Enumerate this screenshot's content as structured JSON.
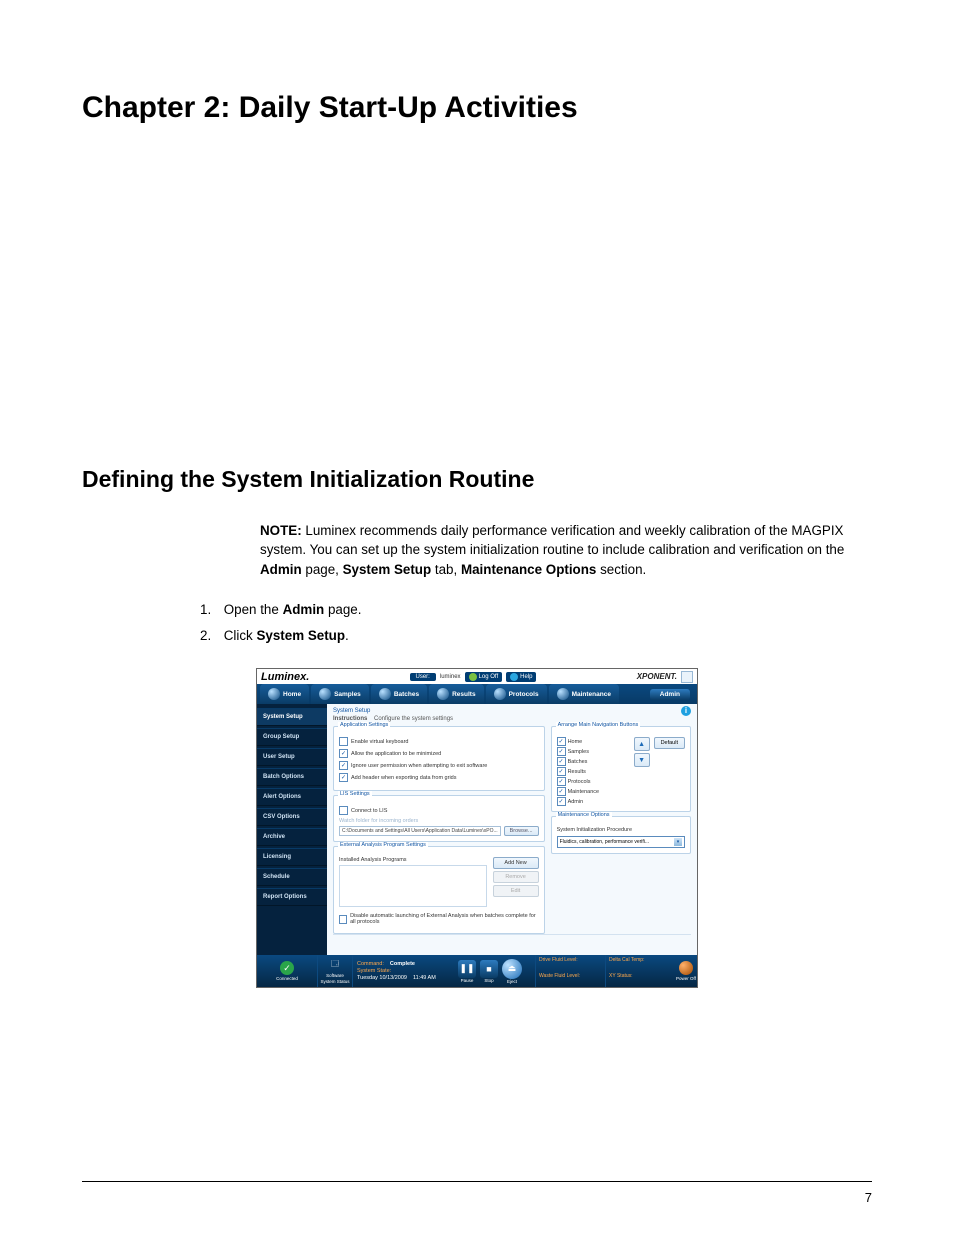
{
  "chapter_title": "Chapter 2: Daily Start-Up Activities",
  "section_title": "Defining the System Initialization Routine",
  "note": {
    "label": "NOTE:",
    "text_before": " Luminex recommends daily performance verification and weekly calibration of the MAGPIX system. You can set up the system initialization routine to include calibration and verification on the ",
    "bold1": "Admin",
    "mid1": " page, ",
    "bold2": "System Setup",
    "mid2": " tab, ",
    "bold3": "Maintenance Options",
    "tail": " section."
  },
  "steps": {
    "s1_a": "Open the ",
    "s1_b": "Admin",
    "s1_c": " page.",
    "s2_a": "Click ",
    "s2_b": "System Setup",
    "s2_c": "."
  },
  "page_number": "7",
  "screenshot": {
    "brand": "Luminex.",
    "user_label": "User:",
    "user_value": "luminex",
    "logoff": "Log Off",
    "help": "Help",
    "product": "XPONENT.",
    "nav": {
      "home": "Home",
      "samples": "Samples",
      "batches": "Batches",
      "results": "Results",
      "protocols": "Protocols",
      "maintenance": "Maintenance",
      "admin": "Admin"
    },
    "sidebar": [
      "System Setup",
      "Group Setup",
      "User Setup",
      "Batch Options",
      "Alert Options",
      "CSV Options",
      "Archive",
      "Licensing",
      "Schedule",
      "Report Options"
    ],
    "crumb": "System Setup",
    "instructions_label": "Instructions",
    "instructions_text": "Configure the system settings",
    "app_settings": {
      "legend": "Application Settings",
      "c1": "Enable virtual keyboard",
      "c2": "Allow the application to be minimized",
      "c3": "Ignore user permission when attempting to exit software",
      "c4": "Add header when exporting data from grids"
    },
    "lis": {
      "legend": "LIS Settings",
      "connect": "Connect to LIS",
      "watch": "Watch folder for incoming orders",
      "path": "C:\\Documents and Settings\\All Users\\Application Data\\Luminex\\xPO...",
      "browse": "Browse..."
    },
    "ext": {
      "legend": "External Analysis Program Settings",
      "label": "Installed Analysis Programs",
      "add": "Add New",
      "remove": "Remove",
      "edit": "Edit",
      "disable": "Disable automatic launching of External Analysis when batches complete for all protocols"
    },
    "arrange": {
      "legend": "Arrange Main Navigation Buttons",
      "items": [
        "Home",
        "Samples",
        "Batches",
        "Results",
        "Protocols",
        "Maintenance",
        "Admin"
      ],
      "default": "Default"
    },
    "maint": {
      "legend": "Maintenance Options",
      "label": "System Initialization Procedure",
      "value": "Fluidics, calibration, performance verifi..."
    },
    "status": {
      "connected": "Connected",
      "software": "Software",
      "system_status": "System Status",
      "command_label": "Command:",
      "command_value": "Complete",
      "state_label": "System State:",
      "date": "Tuesday 10/13/2009",
      "time": "11:49 AM",
      "pause": "Pause",
      "stop": "Stop",
      "eject": "Eject",
      "drive": "Drive Fluid Level:",
      "waste": "Waste Fluid Level:",
      "delta": "Delta Cal Temp:",
      "xy": "XY Status:",
      "power": "Power Off"
    }
  }
}
